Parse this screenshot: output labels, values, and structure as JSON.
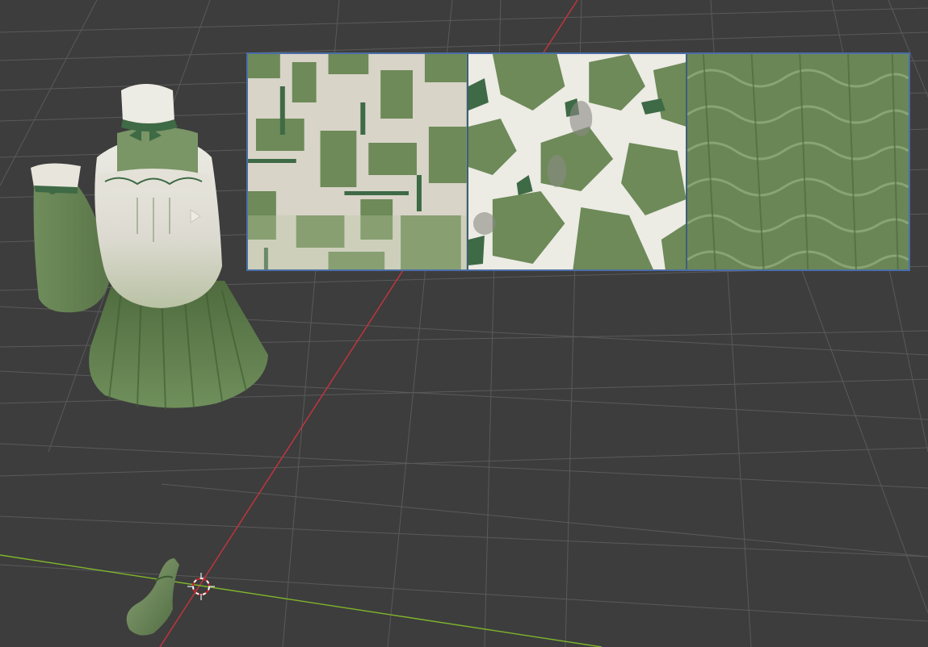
{
  "viewport": {
    "background_color": "#3d3d3d",
    "grid_line_color": "#5a5a5a",
    "x_axis_color": "#c8343f",
    "y_axis_color": "#7fb52c"
  },
  "scene_objects": [
    {
      "name": "dress-model",
      "type": "mesh"
    },
    {
      "name": "sleeve-model",
      "type": "mesh"
    },
    {
      "name": "shoe-model",
      "type": "mesh"
    },
    {
      "name": "3d-cursor",
      "type": "cursor"
    }
  ],
  "texture_plane": {
    "panels": [
      {
        "name": "texture-panel-diffuse-atlas",
        "base_color": "#d8d4c8",
        "accent_color": "#6d8a58"
      },
      {
        "name": "texture-panel-mottled",
        "base_color": "#6d8a58",
        "accent_color": "#ecebe4"
      },
      {
        "name": "texture-panel-ruffles",
        "base_color": "#6a8657",
        "accent_color": "#8faa78"
      }
    ],
    "selection_outline_color": "#4a6ea8"
  }
}
